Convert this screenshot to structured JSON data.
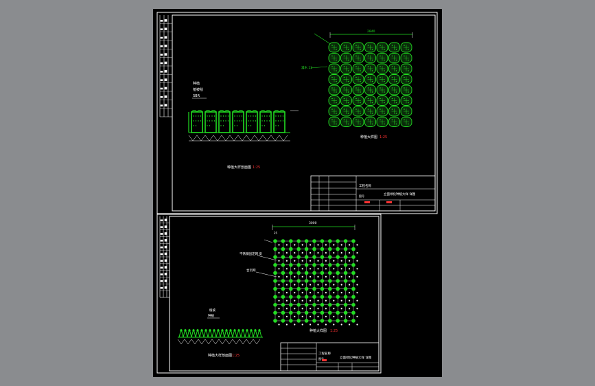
{
  "sheet_top": {
    "elevation_title": "种植大样剖面图",
    "elevation_scale": "1:25",
    "plan_title": "种植大样图",
    "plan_scale": "1:25",
    "dimension": "2840",
    "left_label_lines": [
      "种植",
      "植被毯",
      "SBR"
    ],
    "plant_label": "灌木 13",
    "titleblock_project": "工程名称",
    "titleblock_drawing": "立面绿化种植大样 详图",
    "titleblock_code": "图号"
  },
  "sheet_bottom": {
    "elevation_title": "种植大样剖面图",
    "elevation_scale": "1:25",
    "plan_title": "种植大样图",
    "plan_scale": "1:25",
    "dimension": "3000",
    "dimension_small": "25",
    "left_label_lines": [
      "植被",
      "种植"
    ],
    "callout_1": "不锈钢固定网 宽",
    "callout_2": "合页网",
    "titleblock_project": "工程名称",
    "titleblock_drawing": "立面绿化种植大样 详图",
    "titleblock_code": "图号"
  },
  "colors": {
    "background": "#000000",
    "frame": "#ffffff",
    "plant": "#22dd22",
    "scale": "#ff3333",
    "outer": "#8a8c8f"
  }
}
